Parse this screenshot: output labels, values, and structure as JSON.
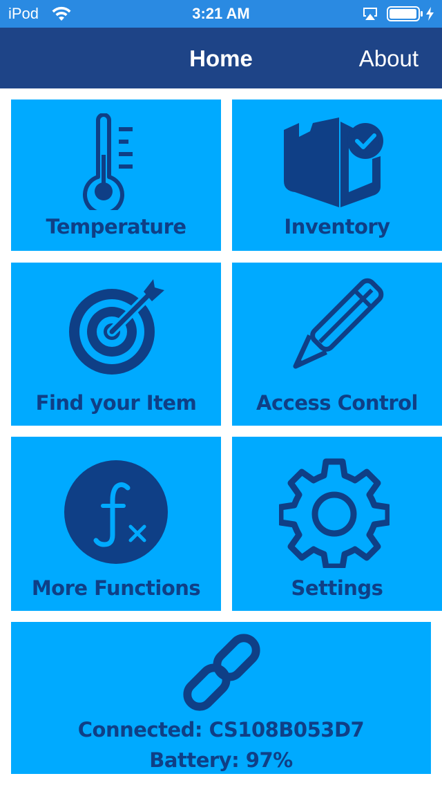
{
  "status_bar": {
    "carrier": "iPod",
    "time": "3:21 AM",
    "icons": [
      "wifi-icon",
      "airplay-icon",
      "battery-icon",
      "charging-bolt-icon"
    ]
  },
  "nav": {
    "title": "Home",
    "about_label": "About"
  },
  "tiles": [
    {
      "label": "Temperature",
      "icon": "thermometer-icon"
    },
    {
      "label": "Inventory",
      "icon": "box-check-icon"
    },
    {
      "label": "Find your Item",
      "icon": "target-arrow-icon"
    },
    {
      "label": "Access Control",
      "icon": "pencil-icon"
    },
    {
      "label": "More Functions",
      "icon": "function-fx-icon"
    },
    {
      "label": "Settings",
      "icon": "gear-icon"
    }
  ],
  "connection": {
    "icon": "link-icon",
    "connected_text": "Connected: CS108B053D7",
    "battery_text": "Battery: 97%"
  },
  "colors": {
    "status_bar": "#2a8ae2",
    "nav_bar": "#1e4487",
    "tile_bg": "#00aaff",
    "tile_fg": "#0f3f86",
    "page_bg": "#ffffff"
  }
}
